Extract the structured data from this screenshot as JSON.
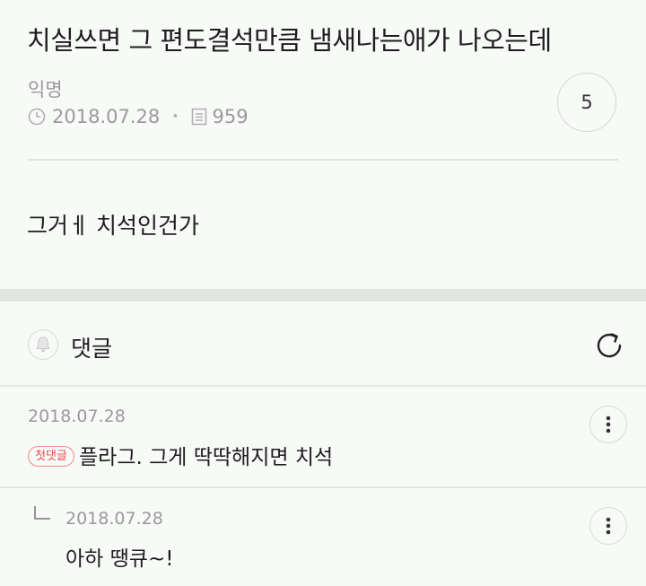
{
  "post": {
    "title": "치실쓰면 그 편도결석만큼 냄새나는애가 나오는데",
    "author": "익명",
    "date": "2018.07.28",
    "views": "959",
    "votes": "5",
    "body": "그거ㅔ 치석인건가"
  },
  "comments_section": {
    "label": "댓글",
    "comments": [
      {
        "date": "2018.07.28",
        "badge": "첫댓글",
        "text": "플라그. 그게 딱딱해지면 치석"
      },
      {
        "date": "2018.07.28",
        "text": "아하 땡큐~!",
        "is_reply": true
      }
    ]
  },
  "icons": {
    "date": "clock-icon",
    "views": "document-icon",
    "subscribe": "bell-icon",
    "refresh": "refresh-icon",
    "more": "more-vertical-icon",
    "reply": "reply-arrow-icon"
  },
  "colors": {
    "background": "#f7faf7",
    "badge": "#e84c4c",
    "muted_text": "#9a9a9a"
  }
}
